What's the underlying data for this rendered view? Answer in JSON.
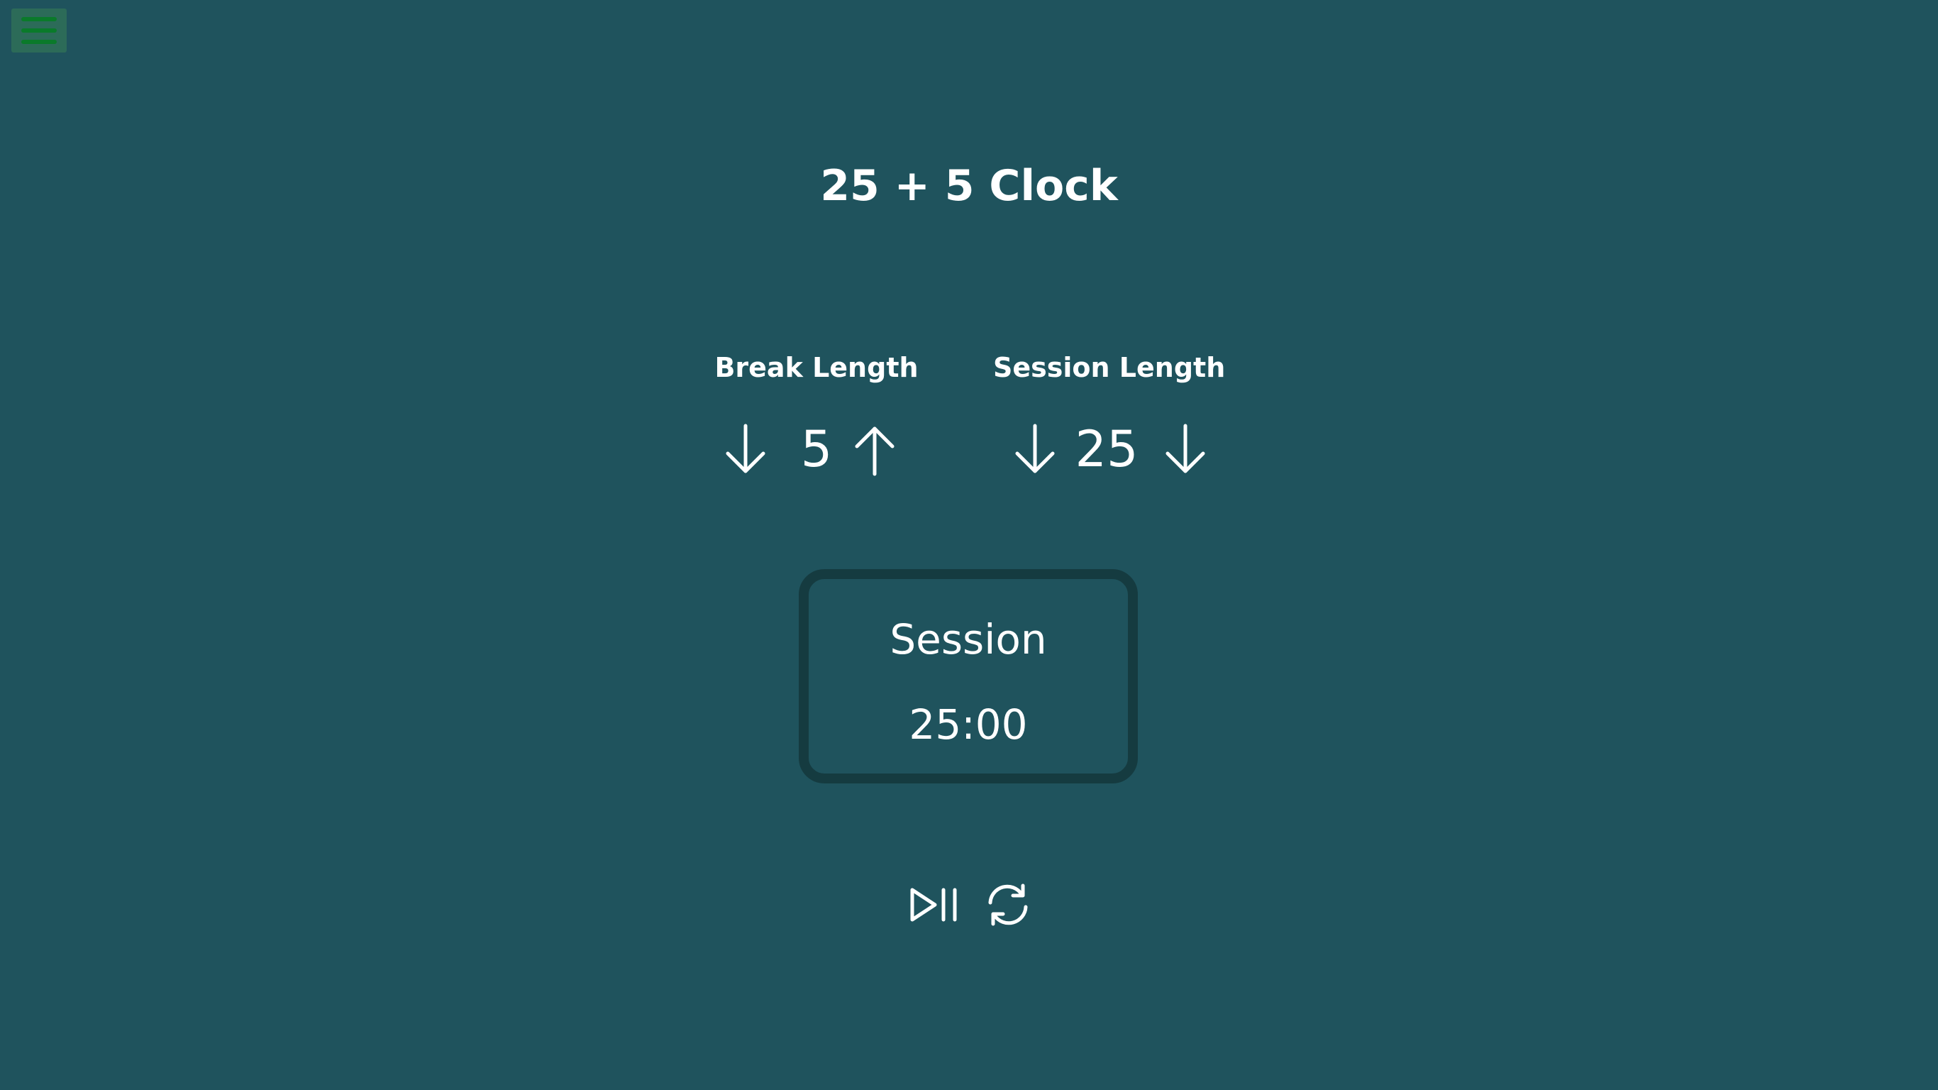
{
  "app": {
    "title": "25 + 5 Clock"
  },
  "menu": {
    "icon": "hamburger-menu-icon",
    "icon_color": "#0a7a2a",
    "button_bg": "#2c6b58"
  },
  "break_length": {
    "label": "Break Length",
    "value": "5",
    "decrement_icon": "arrow-down-icon",
    "increment_icon": "arrow-up-icon"
  },
  "session_length": {
    "label": "Session Length",
    "value": "25",
    "decrement_icon": "arrow-down-icon",
    "increment_icon": "arrow-down-icon"
  },
  "timer": {
    "label": "Session",
    "time": "25:00",
    "border_color": "#153b40"
  },
  "controls": {
    "start_stop_icon": "play-pause-icon",
    "reset_icon": "refresh-icon"
  },
  "colors": {
    "background": "#1f535d",
    "text": "#ffffff"
  }
}
